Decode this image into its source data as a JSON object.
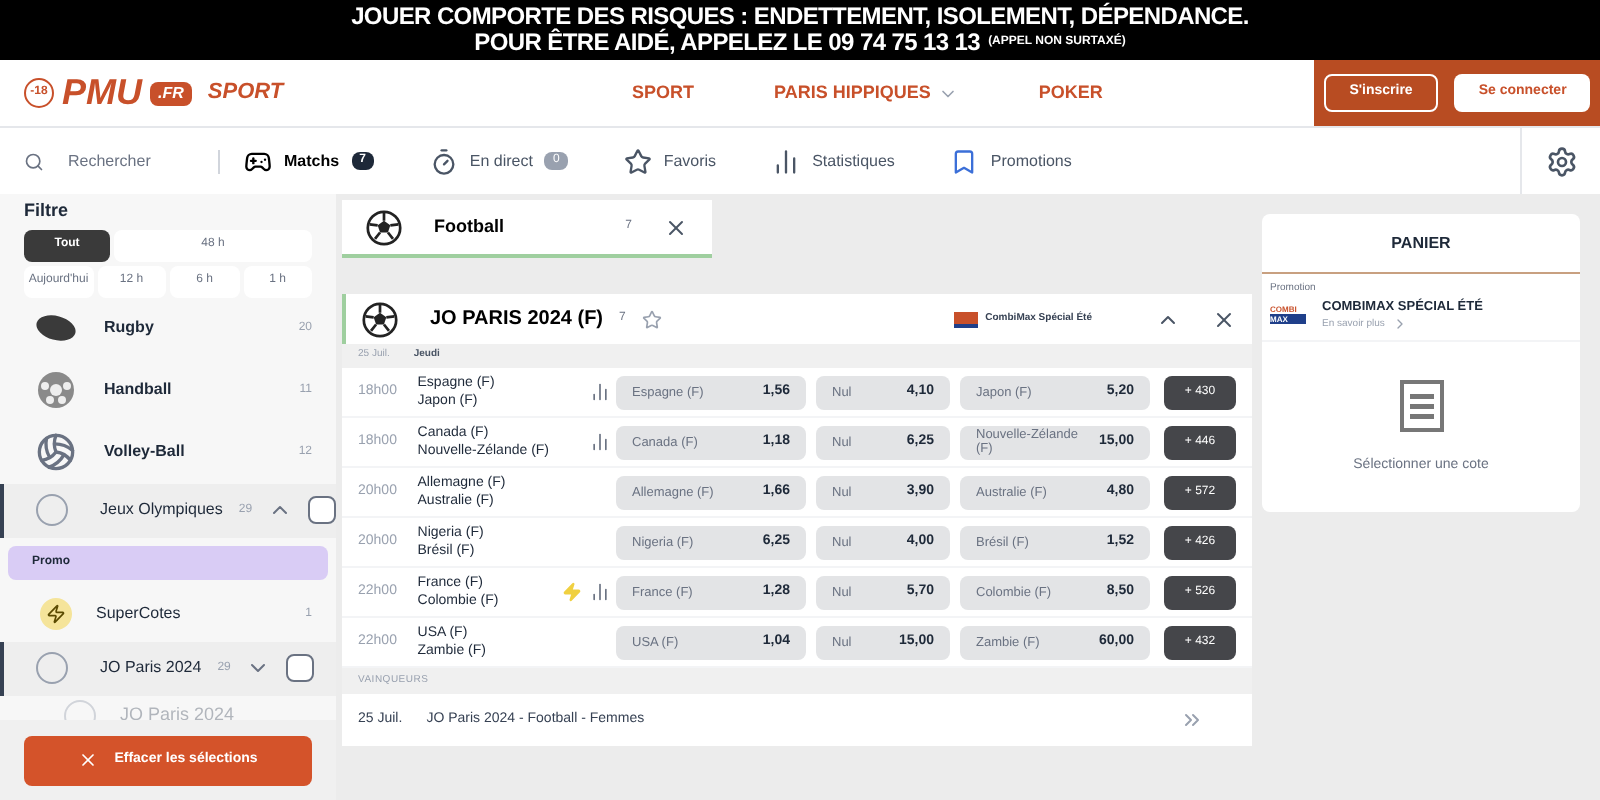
{
  "banner": {
    "line1": "JOUER COMPORTE DES RISQUES : ENDETTEMENT, ISOLEMENT, DÉPENDANCE.",
    "line2": "POUR ÊTRE AIDÉ, APPELEZ LE 09 74 75 13 13",
    "note": "(APPEL NON SURTAXÉ)"
  },
  "header": {
    "age": "-18",
    "logo": "PMU",
    "logo_suffix": ".FR",
    "logo_sport": "SPORT",
    "nav": [
      {
        "label": "SPORT",
        "dropdown": false
      },
      {
        "label": "PARIS HIPPIQUES",
        "dropdown": true
      },
      {
        "label": "POKER",
        "dropdown": false
      }
    ],
    "register": "S'inscrire",
    "login": "Se connecter"
  },
  "toolbar": {
    "search_placeholder": "Rechercher",
    "tabs": [
      {
        "label": "Matchs",
        "count": "7",
        "selected": true
      },
      {
        "label": "En direct",
        "count": "0",
        "selected": false
      },
      {
        "label": "Favoris",
        "selected": false
      },
      {
        "label": "Statistiques",
        "selected": false
      },
      {
        "label": "Promotions",
        "selected": false
      }
    ]
  },
  "sidebar": {
    "title": "Filtre",
    "filters_top": [
      {
        "label": "Tout",
        "selected": true
      },
      {
        "label": "48 h",
        "selected": false
      }
    ],
    "filters_bottom": [
      {
        "label": "Aujourd'hui",
        "selected": false
      },
      {
        "label": "12 h",
        "selected": false
      },
      {
        "label": "6 h",
        "selected": false
      },
      {
        "label": "1 h",
        "selected": false
      }
    ],
    "items": [
      {
        "kind": "sport",
        "label": "Rugby",
        "count": "20"
      },
      {
        "kind": "sport",
        "label": "Handball",
        "count": "11"
      },
      {
        "kind": "sport",
        "label": "Volley-Ball",
        "count": "12"
      },
      {
        "kind": "group",
        "label": "Jeux Olympiques",
        "count": "29",
        "expanded": true,
        "checked": false
      },
      {
        "kind": "promo",
        "label": "Promo"
      },
      {
        "kind": "supercote",
        "label": "SuperCotes",
        "count": "1"
      },
      {
        "kind": "group",
        "label": "JO Paris 2024",
        "count": "29",
        "expanded": false,
        "checked": false
      },
      {
        "kind": "faded",
        "label": "JO Paris 2024"
      }
    ],
    "clear_button": "Effacer les sélections"
  },
  "main": {
    "chip": {
      "label": "Football",
      "count": "7"
    },
    "competition": {
      "title": "JO PARIS 2024 (F)",
      "count": "7",
      "favorite": false,
      "promo": "CombiMax Spécial Été",
      "date": "25 Juil.",
      "day": "Jeudi",
      "matches": [
        {
          "time": "18h00",
          "home": "Espagne (F)",
          "away": "Japon (F)",
          "stats": true,
          "flash": false,
          "odds": [
            {
              "label": "Espagne (F)",
              "value": "1,56"
            },
            {
              "label": "Nul",
              "value": "4,10"
            },
            {
              "label": "Japon (F)",
              "value": "5,20"
            }
          ],
          "more": "+ 430"
        },
        {
          "time": "18h00",
          "home": "Canada (F)",
          "away": "Nouvelle-Zélande (F)",
          "stats": true,
          "flash": false,
          "odds": [
            {
              "label": "Canada (F)",
              "value": "1,18"
            },
            {
              "label": "Nul",
              "value": "6,25"
            },
            {
              "label": "Nouvelle-Zélande (F)",
              "value": "15,00"
            }
          ],
          "more": "+ 446"
        },
        {
          "time": "20h00",
          "home": "Allemagne (F)",
          "away": "Australie (F)",
          "stats": false,
          "flash": false,
          "odds": [
            {
              "label": "Allemagne (F)",
              "value": "1,66"
            },
            {
              "label": "Nul",
              "value": "3,90"
            },
            {
              "label": "Australie (F)",
              "value": "4,80"
            }
          ],
          "more": "+ 572"
        },
        {
          "time": "20h00",
          "home": "Nigeria (F)",
          "away": "Brésil (F)",
          "stats": false,
          "flash": false,
          "odds": [
            {
              "label": "Nigeria (F)",
              "value": "6,25"
            },
            {
              "label": "Nul",
              "value": "4,00"
            },
            {
              "label": "Brésil (F)",
              "value": "1,52"
            }
          ],
          "more": "+ 426"
        },
        {
          "time": "22h00",
          "home": "France (F)",
          "away": "Colombie (F)",
          "stats": true,
          "flash": true,
          "odds": [
            {
              "label": "France (F)",
              "value": "1,28"
            },
            {
              "label": "Nul",
              "value": "5,70"
            },
            {
              "label": "Colombie (F)",
              "value": "8,50"
            }
          ],
          "more": "+ 526"
        },
        {
          "time": "22h00",
          "home": "USA (F)",
          "away": "Zambie (F)",
          "stats": false,
          "flash": false,
          "odds": [
            {
              "label": "USA (F)",
              "value": "1,04"
            },
            {
              "label": "Nul",
              "value": "15,00"
            },
            {
              "label": "Zambie (F)",
              "value": "60,00"
            }
          ],
          "more": "+ 432"
        }
      ],
      "winners_heading": "VAINQUEURS",
      "winners": {
        "date": "25 Juil.",
        "label": "JO Paris 2024 - Football - Femmes"
      }
    }
  },
  "basket": {
    "title": "PANIER",
    "promo_heading": "Promotion",
    "promo_logo_top": "COMBI",
    "promo_logo_bottom": "MAX",
    "promo_title": "COMBIMAX SPÉCIAL ÉTÉ",
    "promo_link": "En savoir plus",
    "empty": "Sélectionner une cote"
  }
}
